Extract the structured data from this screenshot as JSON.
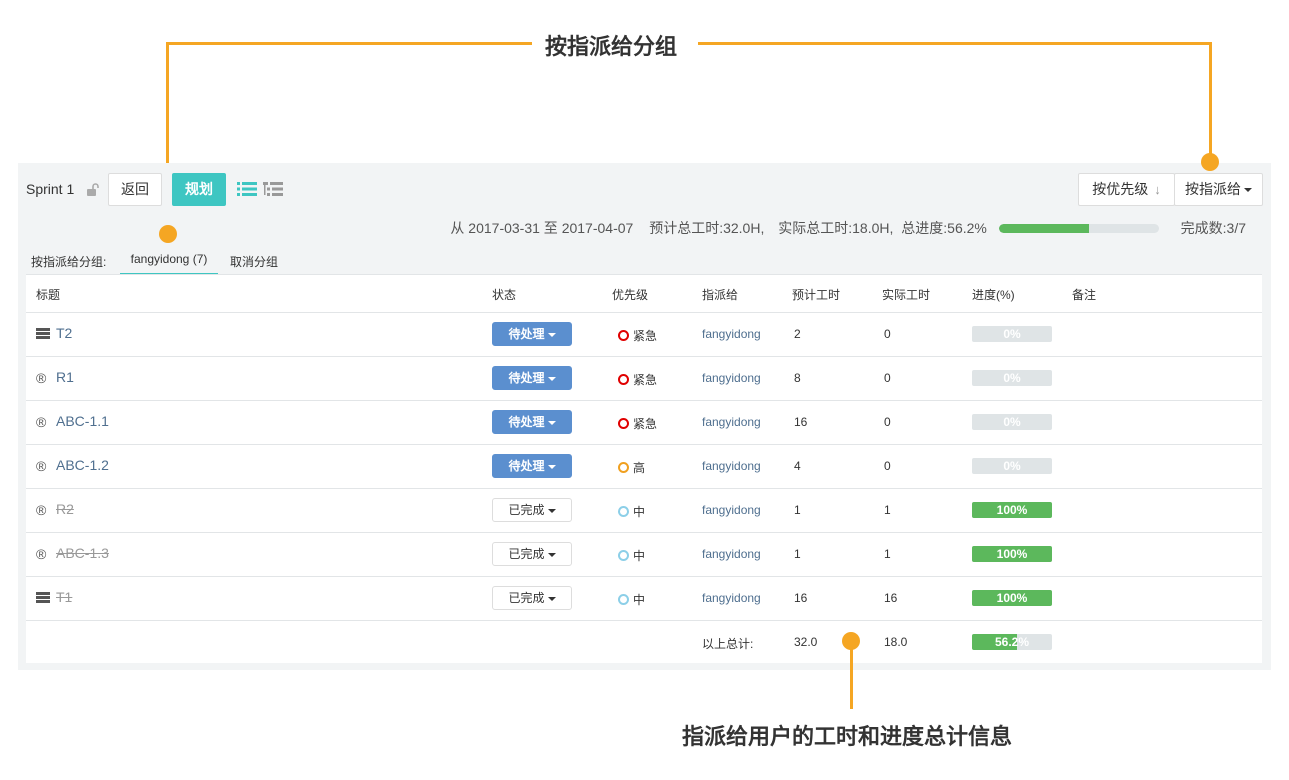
{
  "annotations": {
    "top": "按指派给分组",
    "bottom": "指派给用户的工时和进度总计信息"
  },
  "header": {
    "sprint_name": "Sprint 1",
    "back_label": "返回",
    "plan_label": "规划",
    "sort_label": "按优先级",
    "group_by_label": "按指派给"
  },
  "stats": {
    "date_range": "从 2017-03-31 至 2017-04-07",
    "estimated": "预计总工时:32.0H,",
    "actual": "实际总工时:18.0H,",
    "progress_text": "总进度:56.2%",
    "progress_value": 56.2,
    "done_count": "完成数:3/7"
  },
  "group_bar": {
    "label": "按指派给分组:",
    "tab": "fangyidong (7)",
    "cancel": "取消分组"
  },
  "columns": [
    "标题",
    "状态",
    "优先级",
    "指派给",
    "预计工时",
    "实际工时",
    "进度(%)",
    "备注"
  ],
  "rows": [
    {
      "type": "story",
      "title": "T2",
      "done": false,
      "status": "待处理",
      "priority": "紧急",
      "priority_color": "#e00000",
      "assignee": "fangyidong",
      "estimated": "2",
      "actual": "0",
      "progress": 0,
      "progress_text": "0%"
    },
    {
      "type": "requirement",
      "title": "R1",
      "done": false,
      "status": "待处理",
      "priority": "紧急",
      "priority_color": "#e00000",
      "assignee": "fangyidong",
      "estimated": "8",
      "actual": "0",
      "progress": 0,
      "progress_text": "0%"
    },
    {
      "type": "requirement",
      "title": "ABC-1.1",
      "done": false,
      "status": "待处理",
      "priority": "紧急",
      "priority_color": "#e00000",
      "assignee": "fangyidong",
      "estimated": "16",
      "actual": "0",
      "progress": 0,
      "progress_text": "0%"
    },
    {
      "type": "requirement",
      "title": "ABC-1.2",
      "done": false,
      "status": "待处理",
      "priority": "高",
      "priority_color": "#f0a020",
      "assignee": "fangyidong",
      "estimated": "4",
      "actual": "0",
      "progress": 0,
      "progress_text": "0%"
    },
    {
      "type": "requirement",
      "title": "R2",
      "done": true,
      "status": "已完成",
      "priority": "中",
      "priority_color": "#8ccfe8",
      "assignee": "fangyidong",
      "estimated": "1",
      "actual": "1",
      "progress": 100,
      "progress_text": "100%"
    },
    {
      "type": "requirement",
      "title": "ABC-1.3",
      "done": true,
      "status": "已完成",
      "priority": "中",
      "priority_color": "#8ccfe8",
      "assignee": "fangyidong",
      "estimated": "1",
      "actual": "1",
      "progress": 100,
      "progress_text": "100%"
    },
    {
      "type": "story",
      "title": "T1",
      "done": true,
      "status": "已完成",
      "priority": "中",
      "priority_color": "#8ccfe8",
      "assignee": "fangyidong",
      "estimated": "16",
      "actual": "16",
      "progress": 100,
      "progress_text": "100%"
    }
  ],
  "total": {
    "label": "以上总计:",
    "estimated": "32.0",
    "actual": "18.0",
    "progress": 56.2,
    "progress_text": "56.2%"
  },
  "icons": {
    "requirement_glyph": "®"
  }
}
